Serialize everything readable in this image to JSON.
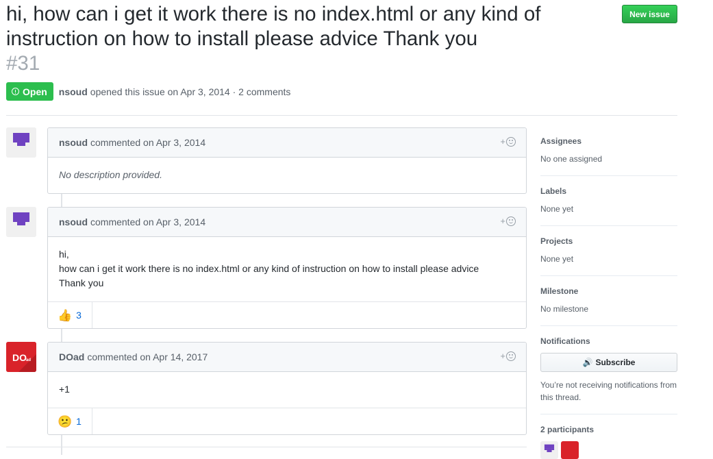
{
  "issue": {
    "title": "hi, how can i get it work there is no index.html or any kind of instruction on how to install please advice Thank you",
    "number": "#31",
    "state": "Open",
    "author": "nsoud",
    "opened_text": "opened this issue on Apr 3, 2014 · 2 comments"
  },
  "header": {
    "new_issue_label": "New issue"
  },
  "comments": [
    {
      "author": "nsoud",
      "meta": "commented on Apr 3, 2014",
      "body": "No description provided."
    },
    {
      "author": "nsoud",
      "meta": "commented on Apr 3, 2014",
      "body_lines": [
        "hi,",
        "how can i get it work there is no index.html or any kind of instruction on how to install please advice",
        "Thank you"
      ],
      "reaction": {
        "emoji": "👍",
        "count": "3"
      }
    },
    {
      "author": "DOad",
      "meta": "commented on Apr 14, 2017",
      "body": "+1",
      "reaction": {
        "emoji": "😕",
        "count": "1"
      }
    }
  ],
  "reaction_add_label": "+",
  "sidebar": {
    "assignees": {
      "heading": "Assignees",
      "value": "No one assigned"
    },
    "labels": {
      "heading": "Labels",
      "value": "None yet"
    },
    "projects": {
      "heading": "Projects",
      "value": "None yet"
    },
    "milestone": {
      "heading": "Milestone",
      "value": "No milestone"
    },
    "notifications": {
      "heading": "Notifications",
      "button_label": "Subscribe",
      "text": "You’re not receiving notifications from this thread."
    },
    "participants": {
      "heading": "2 participants"
    }
  },
  "colors": {
    "open_green": "#2cbe4e",
    "link_blue": "#0366d6",
    "avatar_purple": "#6f42c1",
    "avatar_red": "#d9232a"
  },
  "icons": [
    "issue-opened-icon",
    "smiley-icon",
    "speaker-icon"
  ]
}
